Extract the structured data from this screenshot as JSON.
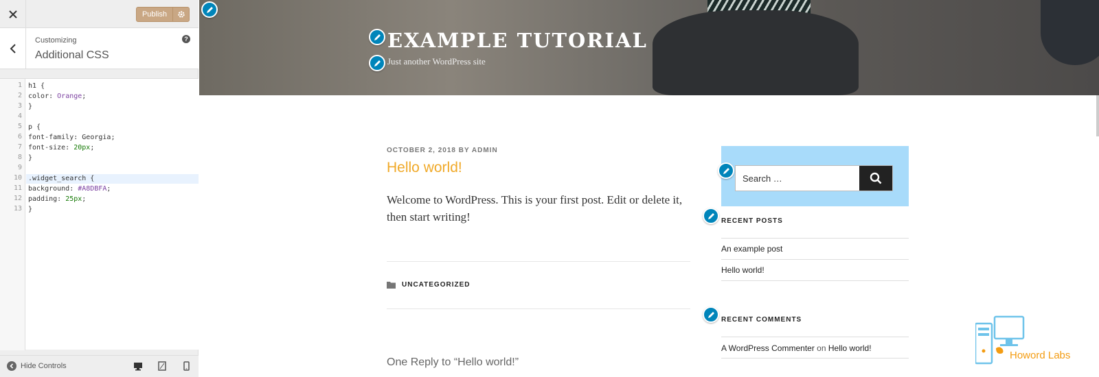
{
  "customizer": {
    "publish_label": "Publish",
    "customizing_label": "Customizing",
    "section_title": "Additional CSS",
    "help_glyph": "?",
    "hide_controls_label": "Hide Controls",
    "accent_color": "#0085ba",
    "publish_color": "#c9a784",
    "code_lines": [
      {
        "num": "1",
        "text": "h1 {"
      },
      {
        "num": "2",
        "text": "color: Orange;"
      },
      {
        "num": "3",
        "text": "}"
      },
      {
        "num": "4",
        "text": ""
      },
      {
        "num": "5",
        "text": "p {"
      },
      {
        "num": "6",
        "text": "font-family: Georgia;"
      },
      {
        "num": "7",
        "text": "font-size: 20px;"
      },
      {
        "num": "8",
        "text": "}"
      },
      {
        "num": "9",
        "text": ""
      },
      {
        "num": "10",
        "text": ".widget_search {"
      },
      {
        "num": "11",
        "text": "background: #A8DBFA;"
      },
      {
        "num": "12",
        "text": "padding: 25px;"
      },
      {
        "num": "13",
        "text": "}"
      }
    ],
    "active_line": 10
  },
  "site": {
    "title": "EXAMPLE TUTORIAL",
    "tagline": "Just another WordPress site"
  },
  "post": {
    "date": "OCTOBER 2, 2018",
    "by": "BY",
    "author": "ADMIN",
    "title": "Hello world!",
    "title_color": "#f0a928",
    "body": "Welcome to WordPress. This is your first post. Edit or delete it, then start writing!",
    "category": "UNCATEGORIZED",
    "reply_title": "One Reply to “Hello world!”"
  },
  "sidebar_widgets": {
    "search_placeholder": "Search …",
    "search_bg": "#A8DBFA",
    "recent_posts_title": "RECENT POSTS",
    "recent_posts": [
      "An example post",
      "Hello world!"
    ],
    "recent_comments_title": "RECENT COMMENTS",
    "comment_author": "A WordPress Commenter",
    "comment_on": "on",
    "comment_post": "Hello world!"
  },
  "watermark": {
    "text": "Howord Labs",
    "color": "#f39c12"
  }
}
